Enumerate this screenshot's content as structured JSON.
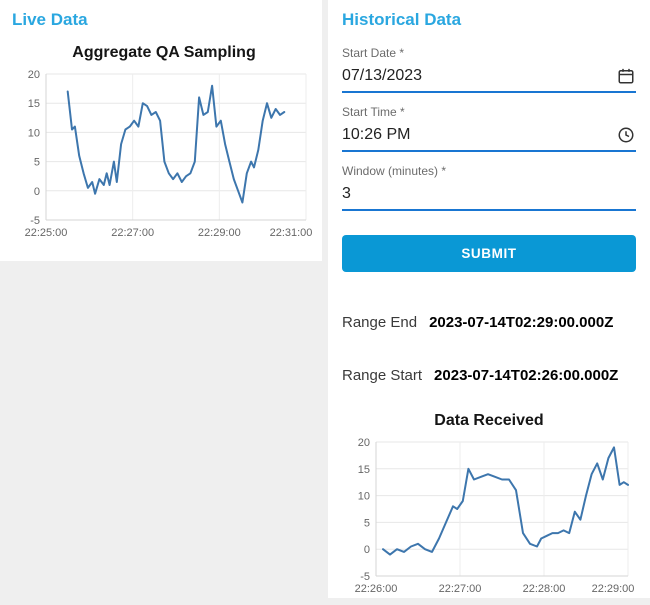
{
  "live_panel": {
    "title": "Live Data"
  },
  "historical_panel": {
    "title": "Historical Data",
    "form": {
      "start_date": {
        "label": "Start Date *",
        "value": "07/13/2023"
      },
      "start_time": {
        "label": "Start Time *",
        "value": "10:26 PM"
      },
      "window": {
        "label": "Window (minutes) *",
        "value": "3"
      },
      "submit_label": "SUBMIT"
    },
    "range_end": {
      "label": "Range End",
      "value": "2023-07-14T02:29:00.000Z"
    },
    "range_start": {
      "label": "Range Start",
      "value": "2023-07-14T02:26:00.000Z"
    }
  },
  "colors": {
    "accent": "#2aa7e0",
    "button": "#0a98d5",
    "line": "#3d76ad"
  },
  "chart_data": [
    {
      "type": "line",
      "title": "Aggregate QA Sampling",
      "xlabel": "",
      "ylabel": "",
      "xlim": [
        0,
        360
      ],
      "ylim": [
        -5,
        20
      ],
      "yticks": [
        -5,
        0,
        5,
        10,
        15,
        20
      ],
      "xticks": [
        {
          "v": 0,
          "label": "22:25:00"
        },
        {
          "v": 120,
          "label": "22:27:00"
        },
        {
          "v": 240,
          "label": "22:29:00"
        },
        {
          "v": 360,
          "label": "22:31:00"
        }
      ],
      "grid": true,
      "legend": "none",
      "line_color": "#3d76ad",
      "points": [
        [
          30,
          17
        ],
        [
          36,
          10.5
        ],
        [
          40,
          11
        ],
        [
          46,
          6
        ],
        [
          52,
          3
        ],
        [
          58,
          0.5
        ],
        [
          64,
          1.5
        ],
        [
          68,
          -0.5
        ],
        [
          74,
          2
        ],
        [
          80,
          1
        ],
        [
          84,
          3
        ],
        [
          88,
          1
        ],
        [
          94,
          5
        ],
        [
          98,
          1.5
        ],
        [
          104,
          8
        ],
        [
          110,
          10.5
        ],
        [
          116,
          11
        ],
        [
          122,
          12
        ],
        [
          128,
          11
        ],
        [
          134,
          15
        ],
        [
          140,
          14.5
        ],
        [
          146,
          13
        ],
        [
          152,
          13.5
        ],
        [
          158,
          12
        ],
        [
          164,
          5
        ],
        [
          170,
          3
        ],
        [
          176,
          2
        ],
        [
          182,
          3
        ],
        [
          188,
          1.5
        ],
        [
          194,
          2.5
        ],
        [
          200,
          3
        ],
        [
          206,
          5
        ],
        [
          212,
          16
        ],
        [
          218,
          13
        ],
        [
          224,
          13.5
        ],
        [
          230,
          18
        ],
        [
          236,
          11
        ],
        [
          242,
          12
        ],
        [
          248,
          8
        ],
        [
          254,
          5
        ],
        [
          260,
          2
        ],
        [
          266,
          0
        ],
        [
          272,
          -2
        ],
        [
          278,
          3
        ],
        [
          284,
          5
        ],
        [
          288,
          4
        ],
        [
          294,
          7
        ],
        [
          300,
          12
        ],
        [
          306,
          15
        ],
        [
          312,
          12.5
        ],
        [
          318,
          14
        ],
        [
          324,
          13
        ],
        [
          330,
          13.5
        ]
      ]
    },
    {
      "type": "line",
      "title": "Data Received",
      "xlabel": "",
      "ylabel": "",
      "xlim": [
        0,
        180
      ],
      "ylim": [
        -5,
        20
      ],
      "yticks": [
        -5,
        0,
        5,
        10,
        15,
        20
      ],
      "xticks": [
        {
          "v": 0,
          "label": "22:26:00"
        },
        {
          "v": 60,
          "label": "22:27:00"
        },
        {
          "v": 120,
          "label": "22:28:00"
        },
        {
          "v": 180,
          "label": "22:29:00"
        }
      ],
      "grid": true,
      "legend": "none",
      "line_color": "#3d76ad",
      "points": [
        [
          5,
          0
        ],
        [
          10,
          -1
        ],
        [
          15,
          0
        ],
        [
          20,
          -0.5
        ],
        [
          25,
          0.5
        ],
        [
          30,
          1
        ],
        [
          35,
          0
        ],
        [
          40,
          -0.5
        ],
        [
          45,
          2
        ],
        [
          50,
          5
        ],
        [
          55,
          8
        ],
        [
          58,
          7.5
        ],
        [
          62,
          9
        ],
        [
          66,
          15
        ],
        [
          70,
          13
        ],
        [
          75,
          13.5
        ],
        [
          80,
          14
        ],
        [
          85,
          13.5
        ],
        [
          90,
          13
        ],
        [
          95,
          13
        ],
        [
          100,
          11
        ],
        [
          105,
          3
        ],
        [
          110,
          1
        ],
        [
          115,
          0.5
        ],
        [
          118,
          2
        ],
        [
          122,
          2.5
        ],
        [
          126,
          3
        ],
        [
          130,
          3
        ],
        [
          134,
          3.5
        ],
        [
          138,
          3
        ],
        [
          142,
          7
        ],
        [
          146,
          5.5
        ],
        [
          150,
          10
        ],
        [
          154,
          14
        ],
        [
          158,
          16
        ],
        [
          162,
          13
        ],
        [
          166,
          17
        ],
        [
          170,
          19
        ],
        [
          174,
          12
        ],
        [
          177,
          12.5
        ],
        [
          180,
          12
        ]
      ]
    }
  ]
}
